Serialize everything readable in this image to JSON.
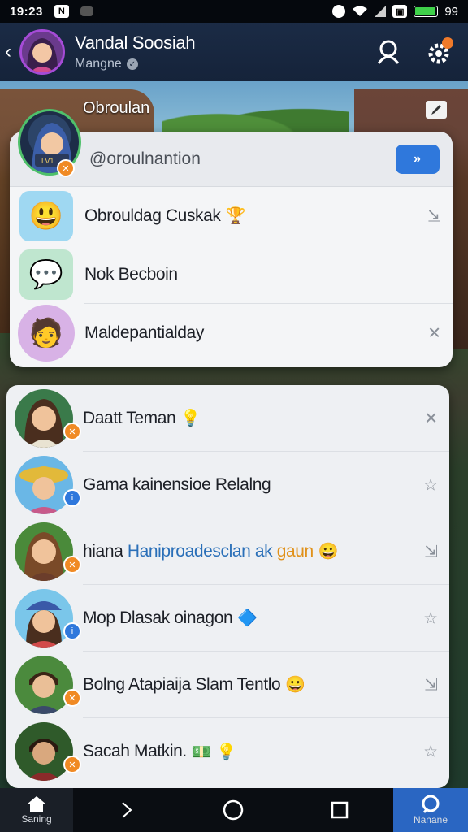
{
  "status": {
    "time": "19:23",
    "notif_glyph": "N",
    "battery_label": "99",
    "battery_level": 0.95,
    "icons": [
      "whatsapp-icon",
      "wifi-icon",
      "signal-icon",
      "sim-icon",
      "battery-icon"
    ]
  },
  "header": {
    "title": "Vandal Soosiah",
    "subtitle": "Mangne",
    "back_glyph": "‹"
  },
  "background": {
    "title": "Obroulan"
  },
  "search": {
    "text": "@oroulnantion",
    "go_label": "»"
  },
  "menu_items": [
    {
      "label": "Obrouldag Cuskak",
      "emoji": "🏆",
      "thumb": "😃",
      "thumb_bg": "#9fd8f2",
      "arrow": "⇲"
    },
    {
      "label": "Nok Becboin",
      "emoji": "",
      "thumb": "💬",
      "thumb_bg": "#bfe6cf",
      "arrow": ""
    },
    {
      "label": "Maldepantialday",
      "emoji": "",
      "thumb": "🧑",
      "thumb_bg": "#d8b2e6",
      "arrow": "✕"
    }
  ],
  "friends": [
    {
      "name": "Daatt Teman",
      "suffix": "💡",
      "avatar_bg": "#3a7a4a",
      "face": "👩",
      "badge": "orange",
      "action": "✕"
    },
    {
      "name": "Gama kainensioe Relalng",
      "suffix": "",
      "avatar_bg": "#6ab7e6",
      "face": "👩‍🌾",
      "badge": "blue",
      "action": "☆"
    },
    {
      "name": "hiana",
      "name_blue": "Haniproadesclan ak",
      "name_orange": "gaun",
      "suffix": "😀",
      "avatar_bg": "#4a8a3a",
      "face": "👩",
      "badge": "orange",
      "action": "⇲"
    },
    {
      "name": "Mop Dlasak oinagon",
      "suffix": "🔷",
      "avatar_bg": "#7ac6ea",
      "face": "👩",
      "badge": "blue",
      "action": "☆"
    },
    {
      "name": "Bolng Atapiaija Slam Tentlo",
      "suffix": "😀",
      "avatar_bg": "#4b8a3d",
      "face": "👨",
      "badge": "orange",
      "action": "⇲"
    },
    {
      "name": "Sacah Matkin.",
      "suffix": "💵 💡",
      "avatar_bg": "#2f5a2a",
      "face": "🧑",
      "badge": "orange",
      "action": "☆"
    }
  ],
  "nav": {
    "home_label": "Saning",
    "active_label": "Nanane"
  }
}
